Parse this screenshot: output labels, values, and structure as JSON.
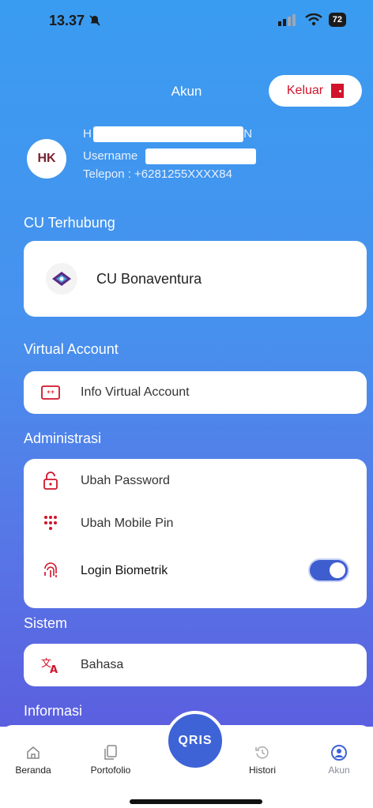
{
  "status": {
    "time": "13.37",
    "battery": "72"
  },
  "header": {
    "title": "Akun",
    "logout_label": "Keluar"
  },
  "profile": {
    "initials": "HK",
    "name_start": "H",
    "name_end": "N",
    "username_label": "Username",
    "phone": "Telepon : +6281255XXXX84"
  },
  "sections": {
    "cu": {
      "title": "CU Terhubung",
      "item": "CU Bonaventura"
    },
    "va": {
      "title": "Virtual Account",
      "item": "Info Virtual Account"
    },
    "admin": {
      "title": "Administrasi",
      "items": [
        "Ubah Password",
        "Ubah Mobile Pin",
        "Login Biometrik"
      ],
      "biometric_enabled": true
    },
    "system": {
      "title": "Sistem",
      "item": "Bahasa"
    },
    "info": {
      "title": "Informasi"
    }
  },
  "nav": {
    "items": [
      "Beranda",
      "Portofolio",
      "Histori",
      "Akun"
    ],
    "qris_label": "QRIS",
    "active": "Akun",
    "active_color": "#3e63d6"
  }
}
